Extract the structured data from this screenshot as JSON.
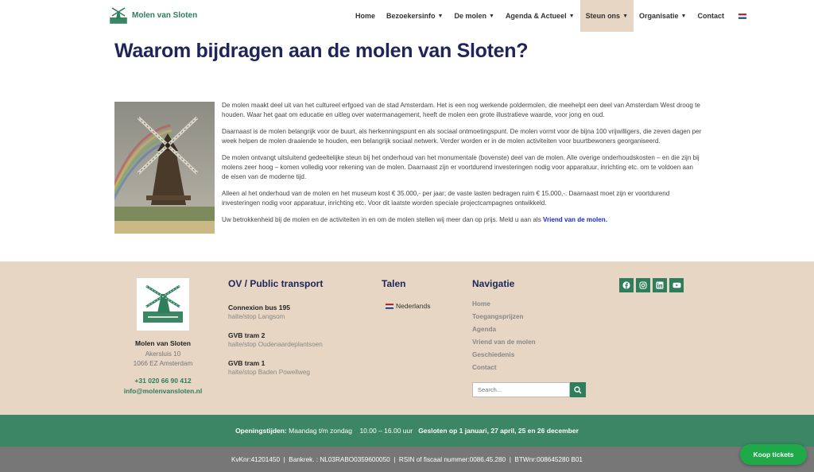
{
  "header": {
    "logo_text": "Molen van Sloten",
    "nav": [
      {
        "label": "Home",
        "has_dropdown": false
      },
      {
        "label": "Bezoekersinfo",
        "has_dropdown": true
      },
      {
        "label": "De molen",
        "has_dropdown": true
      },
      {
        "label": "Agenda & Actueel",
        "has_dropdown": true
      },
      {
        "label": "Steun ons",
        "has_dropdown": true,
        "active": true
      },
      {
        "label": "Organisatie",
        "has_dropdown": true
      },
      {
        "label": "Contact",
        "has_dropdown": false
      }
    ],
    "language_flag": "flag-nl-icon"
  },
  "main": {
    "title": "Waarom bijdragen aan de molen van Sloten?",
    "paragraphs": [
      "De molen maakt deel uit van het cultureel erfgoed van de stad Amsterdam. Het is een nog werkende poldermolen, die meehelpt een deel van Amsterdam West droog te houden. Waar het gaat om educatie en uitleg over watermanagement, heeft de molen een grote illustratieve waarde, voor jong en oud.",
      "Daarnaast is de molen belangrijk voor de buurt, als herkenningspunt en als sociaal ontmoetingspunt. De molen vormt voor de bijna 100 vrijwilligers, die zeven dagen per week helpen de molen draaiende te houden, een belangrijk sociaal netwerk. Verder worden er in de molen activiteiten voor buurtbewoners georganiseerd.",
      "De molen ontvangt uitsluitend gedeeltelijke steun bij het onderhoud van het monumentale (bovenste) deel van de molen. Alle overige onderhoudskosten – en die zijn bij molens zeer hoog – komen volledig voor rekening van de molen. Daarnaast zijn er voortdurend investeringen nodig voor apparatuur, inrichting etc. om te voldoen aan de eisen van de moderne tijd.",
      "Alleen al het onderhoud van de molen en het museum kost € 35.000,- per jaar; de vaste lasten bedragen ruim € 15.000,-. Daarnaast moet zijn er voortdurend investeringen nodig voor apparatuur, inrichting etc. Voor dit laatste worden speciale projectcampagnes ontwikkeld."
    ],
    "last_paragraph_text": "Uw betrokkenheid bij de molen en de activiteiten in en om de molen stellen wij meer dan op prijs. Meld u aan als ",
    "last_paragraph_link": "Vriend van de molen."
  },
  "footer": {
    "org_name": "Molen van Sloten",
    "address_line1": "Akersluis 10",
    "address_line2": "1066 EZ  Amsterdam",
    "phone": "+31 020 66 90 412",
    "email": "info@molenvansloten.nl",
    "transport_heading": "OV / Public transport",
    "transport": [
      {
        "title": "Connexion bus 195",
        "sub": "halte/stop Langsom"
      },
      {
        "title": "GVB tram 2",
        "sub": "halte/stop Oudenaardeplantsoen"
      },
      {
        "title": "GVB tram 1",
        "sub": "halte/stop Baden Powellweg"
      }
    ],
    "languages_heading": "Talen",
    "language": "Nederlands",
    "nav_heading": "Navigatie",
    "nav_links": [
      "Home",
      "Toegangsprijzen",
      "Agenda",
      "Vriend van de molen",
      "Geschiedenis",
      "Contact"
    ],
    "search_placeholder": "Search...",
    "socials": [
      "facebook-icon",
      "instagram-icon",
      "linkedin-icon",
      "youtube-icon"
    ]
  },
  "hours": {
    "label": "Openingstijden:",
    "days": "Maandag t/m zondag",
    "time": "10.00 – 16.00 uur",
    "closed": "Gesloten op 1 januari, 27 april, 25 en 26 december"
  },
  "bottom_bar": {
    "text": "KvKnr:41201450  |  Bankrek. : NL03RABO0359600050  |  RSIN of fiscaal nummer:0086.45.280  |  BTWnr:008645280 B01"
  },
  "ticket_button": "Koop tickets",
  "colors": {
    "brand_green": "#2e7d5b",
    "title_navy": "#1f2459",
    "footer_beige": "#e6d6c3",
    "hours_green": "#3c8565",
    "bottom_gray": "#777777",
    "ticket_green": "#1faa4a",
    "link_blue": "#1a2ad6"
  }
}
